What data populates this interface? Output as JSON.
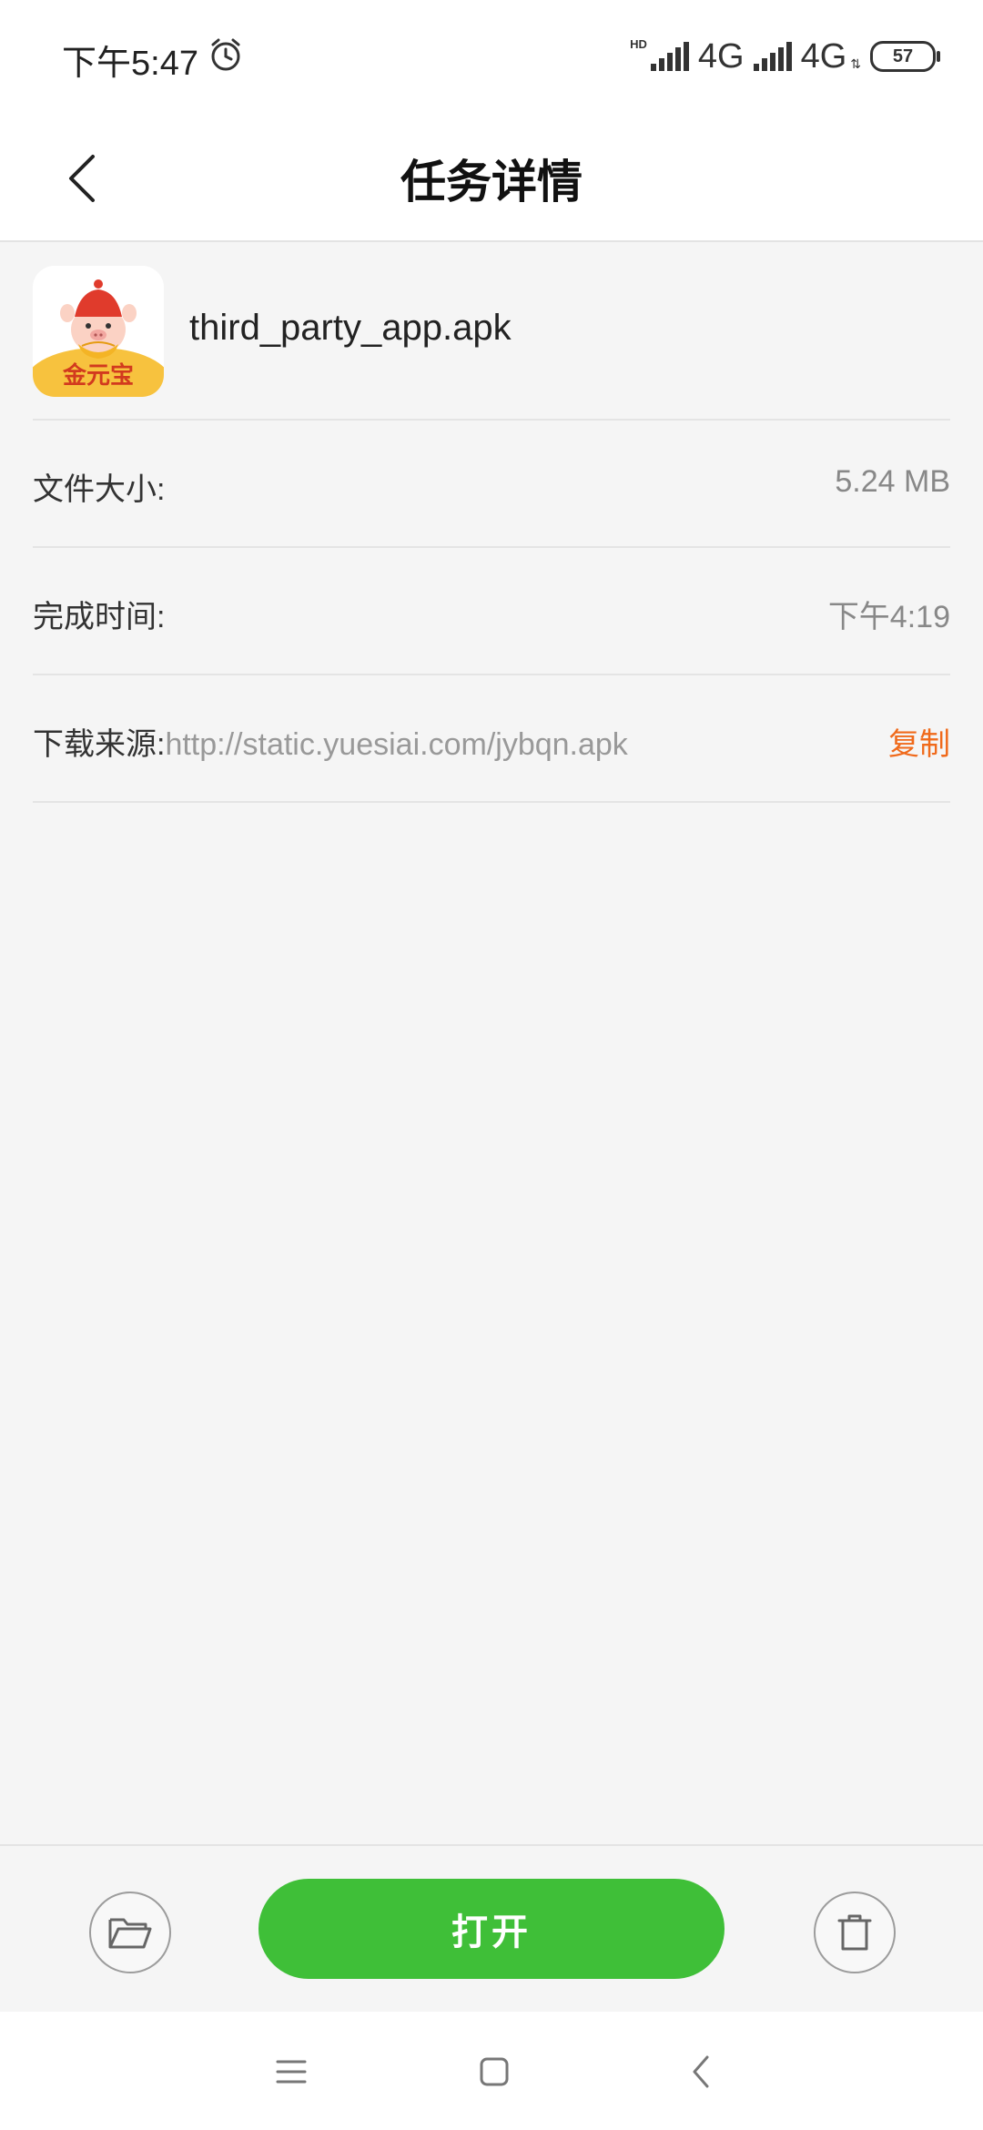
{
  "status_bar": {
    "time": "下午5:47",
    "network_1": "4G",
    "network_2": "4G",
    "hd_label": "HD",
    "battery_level": "57",
    "icons": [
      "alarm-icon",
      "signal-icon",
      "signal-icon",
      "battery-icon"
    ]
  },
  "header": {
    "title": "任务详情",
    "back_icon": "chevron-left-icon"
  },
  "file": {
    "name": "third_party_app.apk",
    "icon_caption": "金元宝"
  },
  "details": {
    "size_label": "文件大小:",
    "size_value": "5.24 MB",
    "time_label": "完成时间:",
    "time_value": "下午4:19",
    "source_label": "下载来源:",
    "source_url": "http://static.yuesiai.com/jybqn.apk",
    "copy_label": "复制"
  },
  "actions": {
    "open_label": "打开",
    "folder_icon": "folder-open-icon",
    "delete_icon": "trash-icon"
  },
  "colors": {
    "accent_green": "#3fbf38",
    "copy_orange": "#f06a1b",
    "background": "#f5f5f5"
  }
}
